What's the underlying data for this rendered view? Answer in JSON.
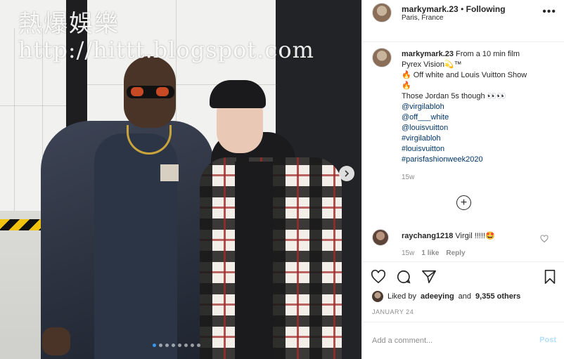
{
  "watermark": {
    "line1": "熱爆娛樂",
    "line2": "http://hittt.blogspot.com"
  },
  "header": {
    "username": "markymark.23",
    "separator": " • ",
    "follow_status": "Following",
    "location": "Paris, France",
    "more_icon": "more-horizontal-icon"
  },
  "caption": {
    "username": "markymark.23",
    "lines": [
      "From a 10 min film",
      "Pyrex Vision💫™",
      "🔥 Off white and Louis Vuitton Show",
      "🔥",
      "Those Jordan 5s though 👀👀"
    ],
    "tags": [
      "@virgilabloh",
      "@off___white",
      "@louisvuitton",
      "#virgilabloh",
      "#louisvuitton",
      "#parisfashionweek2020"
    ],
    "time": "15w"
  },
  "load_more_icon": "plus-circle-icon",
  "comment": {
    "username": "raychang1218",
    "text": "Virgil !!!!!🤩",
    "time": "15w",
    "likes": "1 like",
    "reply": "Reply"
  },
  "actions": {
    "like": "heart-icon",
    "comment": "comment-icon",
    "share": "send-icon",
    "save": "bookmark-icon"
  },
  "likes": {
    "prefix": "Liked by",
    "user": "adeeying",
    "conj": "and",
    "others": "9,355 others"
  },
  "date": "JANUARY 24",
  "add_comment": {
    "placeholder": "Add a comment...",
    "post_label": "Post"
  },
  "carousel": {
    "dot_count": 8,
    "active_index": 0
  },
  "colors": {
    "link": "#003569",
    "post_disabled": "#b2dffc",
    "active_dot": "#3897f0",
    "muted": "#8e8e8e"
  }
}
